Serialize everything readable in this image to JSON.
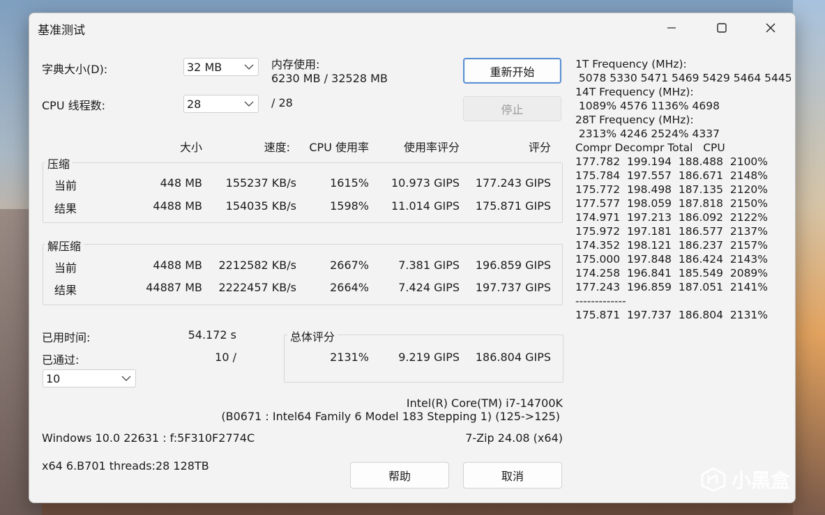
{
  "window": {
    "title": "基准测试"
  },
  "dict": {
    "label": "字典大小(D):",
    "value": "32 MB"
  },
  "threads": {
    "label": "CPU 线程数:",
    "value": "28",
    "max": "/ 28"
  },
  "memory": {
    "label": "内存使用:",
    "value": "6230 MB / 32528 MB"
  },
  "buttons": {
    "restart": "重新开始",
    "stop": "停止",
    "help": "帮助",
    "cancel": "取消"
  },
  "headers": {
    "size": "大小",
    "speed": "速度:",
    "cpu": "CPU 使用率",
    "rating_usage": "使用率评分",
    "rating": "评分"
  },
  "compress": {
    "label": "压缩",
    "rows": [
      {
        "name": "当前",
        "size": "448 MB",
        "speed": "155237 KB/s",
        "cpu": "1615%",
        "rate": "10.973 GIPS",
        "score": "177.243 GIPS"
      },
      {
        "name": "结果",
        "size": "4488 MB",
        "speed": "154035 KB/s",
        "cpu": "1598%",
        "rate": "11.014 GIPS",
        "score": "175.871 GIPS"
      }
    ]
  },
  "decompress": {
    "label": "解压缩",
    "rows": [
      {
        "name": "当前",
        "size": "4488 MB",
        "speed": "2212582 KB/s",
        "cpu": "2667%",
        "rate": "7.381 GIPS",
        "score": "196.859 GIPS"
      },
      {
        "name": "结果",
        "size": "44887 MB",
        "speed": "2222457 KB/s",
        "cpu": "2664%",
        "rate": "7.424 GIPS",
        "score": "197.737 GIPS"
      }
    ]
  },
  "elapsed": {
    "label": "已用时间:",
    "value": "54.172 s"
  },
  "passes": {
    "label": "已通过:",
    "value": "10 /",
    "select": "10"
  },
  "total": {
    "label": "总体评分",
    "cpu": "2131%",
    "rate": "9.219 GIPS",
    "score": "186.804 GIPS"
  },
  "sysinfo": {
    "cpu_name": "Intel(R) Core(TM) i7-14700K",
    "cpu_detail": "(B0671 : Intel64 Family 6 Model 183 Stepping 1) (125->125)",
    "os": "Windows 10.0 22631 :  f:5F310F2774C",
    "version": "7-Zip 24.08 (x64)",
    "arch": "x64 6.B701 threads:28 128TB"
  },
  "log": [
    "1T Frequency (MHz):",
    " 5078 5330 5471 5469 5429 5464 5445",
    "14T Frequency (MHz):",
    " 1089% 4576 1136% 4698",
    "28T Frequency (MHz):",
    " 2313% 4246 2524% 4337",
    "Compr Decompr Total   CPU",
    "177.782  199.194  188.488  2100%",
    "175.784  197.557  186.671  2148%",
    "175.772  198.498  187.135  2120%",
    "177.577  198.059  187.818  2150%",
    "174.971  197.213  186.092  2122%",
    "175.972  197.181  186.577  2137%",
    "174.352  198.121  186.237  2157%",
    "175.000  197.848  186.424  2143%",
    "174.258  196.841  185.549  2089%",
    "177.243  196.859  187.051  2141%",
    "-------------",
    "175.871  197.737  186.804  2131%"
  ],
  "watermark": "小黑盒"
}
